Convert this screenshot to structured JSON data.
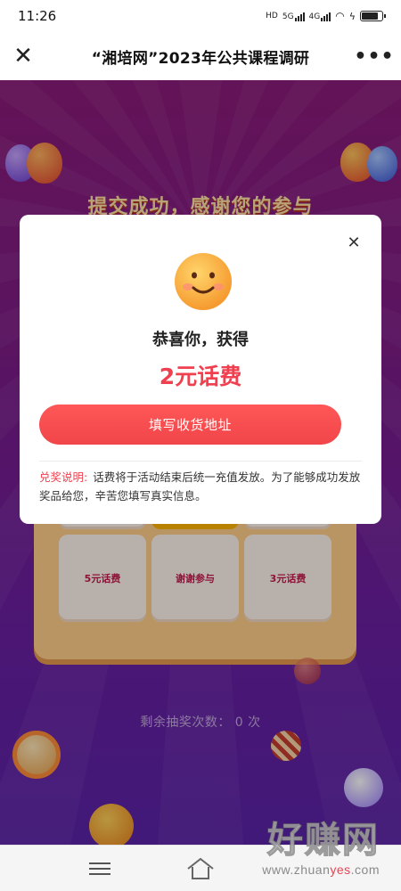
{
  "status_bar": {
    "time": "11:26",
    "network_labels": [
      "HD",
      "5G",
      "4G"
    ]
  },
  "nav": {
    "title": "“湘培网”2023年公共课程调研",
    "close_icon": "close-icon",
    "more_icon": "more-icon"
  },
  "background": {
    "title": "提交成功，感谢您的参与",
    "grid_cells": [
      "5元话费",
      "谢谢参与",
      "3元话费"
    ],
    "remaining_label": "剩余抽奖次数：",
    "remaining_count": "0",
    "remaining_unit": "次"
  },
  "modal": {
    "close_icon": "close-icon",
    "emoji": "smiley-face-icon",
    "congrats": "恭喜你，获得",
    "prize": "2元话费",
    "button_label": "填写收货地址",
    "notice_label": "兑奖说明:",
    "notice_text": "话费将于活动结束后统一充值发放。为了能够成功发放奖品给您，辛苦您填写真实信息。"
  },
  "bottom_bar": {
    "menu_icon": "menu-icon",
    "home_icon": "home-icon"
  },
  "watermark": {
    "brand": "好赚网",
    "url_pre": "www.zhuan",
    "url_hl": "yes",
    "url_post": ".com"
  },
  "colors": {
    "accent_red": "#f0404f",
    "bg_purple": "#7d1c86"
  }
}
